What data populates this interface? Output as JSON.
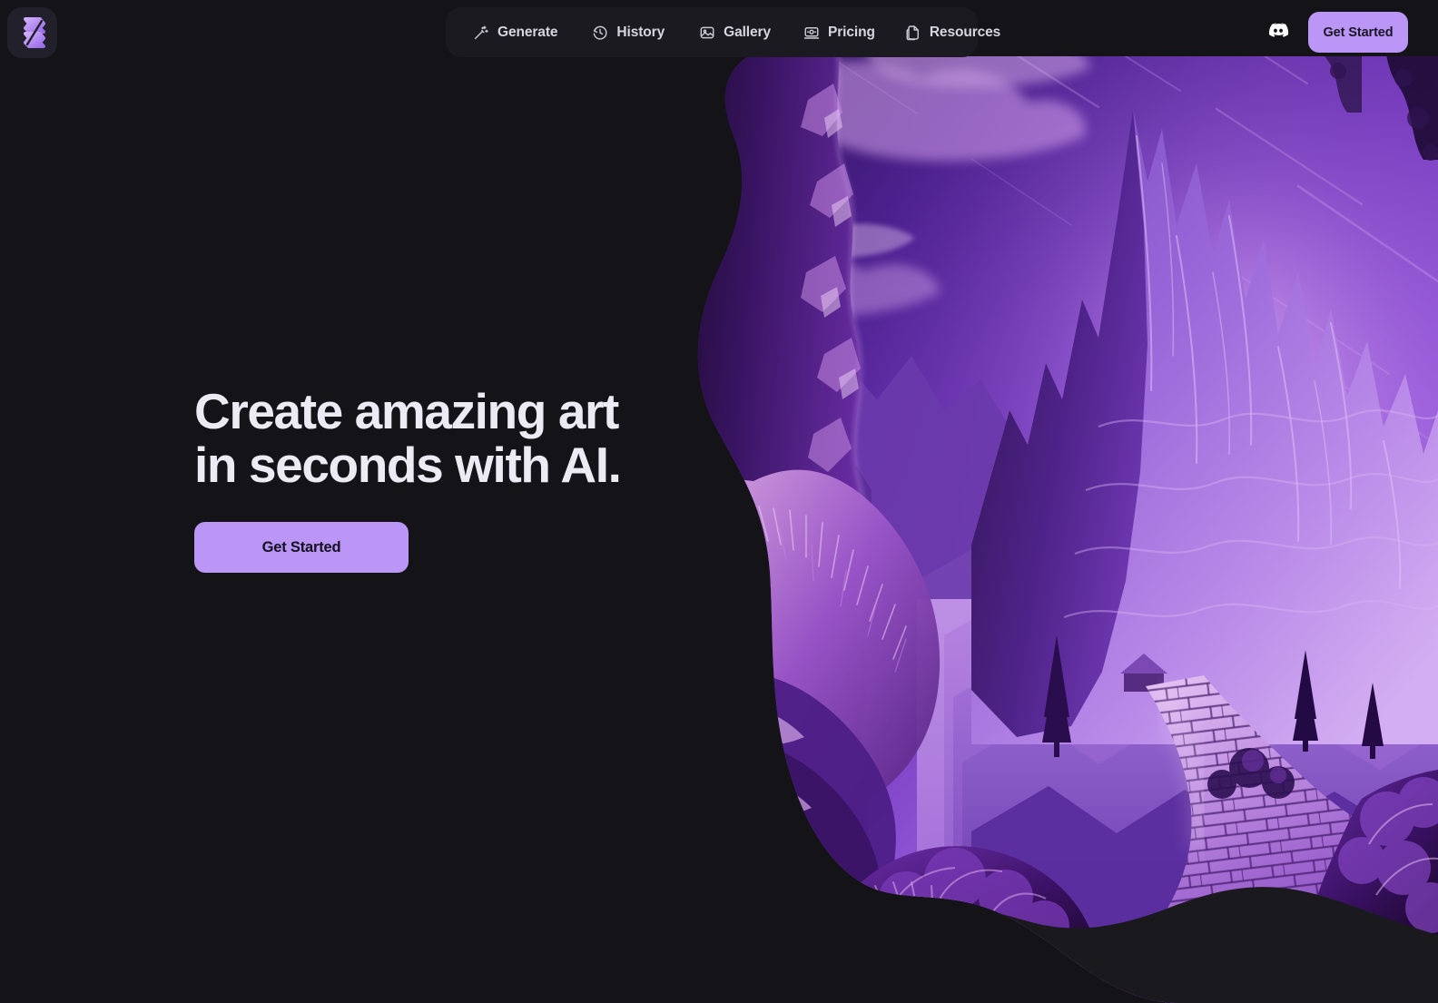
{
  "brand": {
    "logo_icon": "app-logo-icon",
    "logo_alt": "Logo",
    "accent_color": "#bb96f7",
    "background_color": "#141317",
    "navbar_color": "#1b1a20"
  },
  "nav": {
    "items": [
      {
        "label": "Generate",
        "icon": "magic-wand-icon"
      },
      {
        "label": "History",
        "icon": "clock-history-icon"
      },
      {
        "label": "Gallery",
        "icon": "image-icon"
      },
      {
        "label": "Pricing",
        "icon": "pricing-screen-icon"
      },
      {
        "label": "Resources",
        "icon": "document-icon"
      }
    ]
  },
  "topbar": {
    "discord_icon": "discord-icon",
    "get_started_label": "Get Started"
  },
  "hero": {
    "title": "Create amazing art\nin seconds with AI.",
    "cta_label": "Get Started",
    "artwork_alt": "Purple fantasy mountain landscape with cobblestone path"
  }
}
